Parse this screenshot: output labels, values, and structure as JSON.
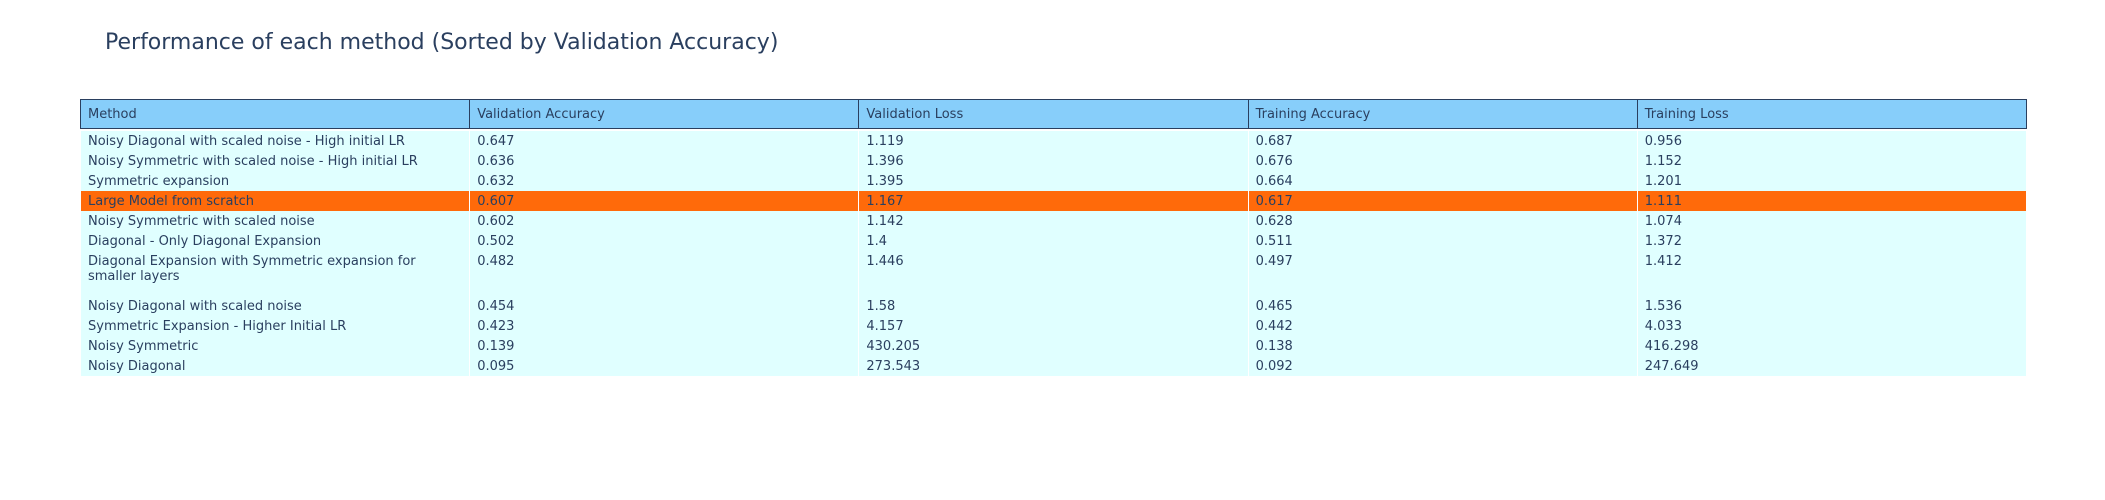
{
  "chart_data": {
    "type": "table",
    "title": "Performance of each method (Sorted by Validation Accuracy)",
    "columns": [
      "Method",
      "Validation Accuracy",
      "Validation Loss",
      "Training Accuracy",
      "Training Loss"
    ],
    "rows": [
      [
        "Noisy Diagonal with scaled noise - High initial LR",
        "0.647",
        "1.119",
        "0.687",
        "0.956"
      ],
      [
        "Noisy Symmetric with scaled noise - High initial LR",
        "0.636",
        "1.396",
        "0.676",
        "1.152"
      ],
      [
        "Symmetric expansion",
        "0.632",
        "1.395",
        "0.664",
        "1.201"
      ],
      [
        "Large Model from scratch",
        "0.607",
        "1.167",
        "0.617",
        "1.111"
      ],
      [
        "Noisy Symmetric with scaled noise",
        "0.602",
        "1.142",
        "0.628",
        "1.074"
      ],
      [
        "Diagonal - Only Diagonal Expansion",
        "0.502",
        "1.4",
        "0.511",
        "1.372"
      ],
      [
        "Diagonal Expansion with Symmetric expansion for smaller layers",
        "0.482",
        "1.446",
        "0.497",
        "1.412"
      ],
      [
        "Noisy Diagonal with scaled noise",
        "0.454",
        "1.58",
        "0.465",
        "1.536"
      ],
      [
        "Symmetric Expansion - Higher Initial LR",
        "0.423",
        "4.157",
        "0.442",
        "4.033"
      ],
      [
        "Noisy Symmetric",
        "0.139",
        "430.205",
        "0.138",
        "416.298"
      ],
      [
        "Noisy Diagonal",
        "0.095",
        "273.543",
        "0.092",
        "247.649"
      ]
    ],
    "highlight_row": 3,
    "colors": {
      "header_fill": "#87cefa",
      "cell_fill": "#e0ffff",
      "highlight_fill": "#ff6a0a",
      "text": "#2a3f5f"
    }
  }
}
